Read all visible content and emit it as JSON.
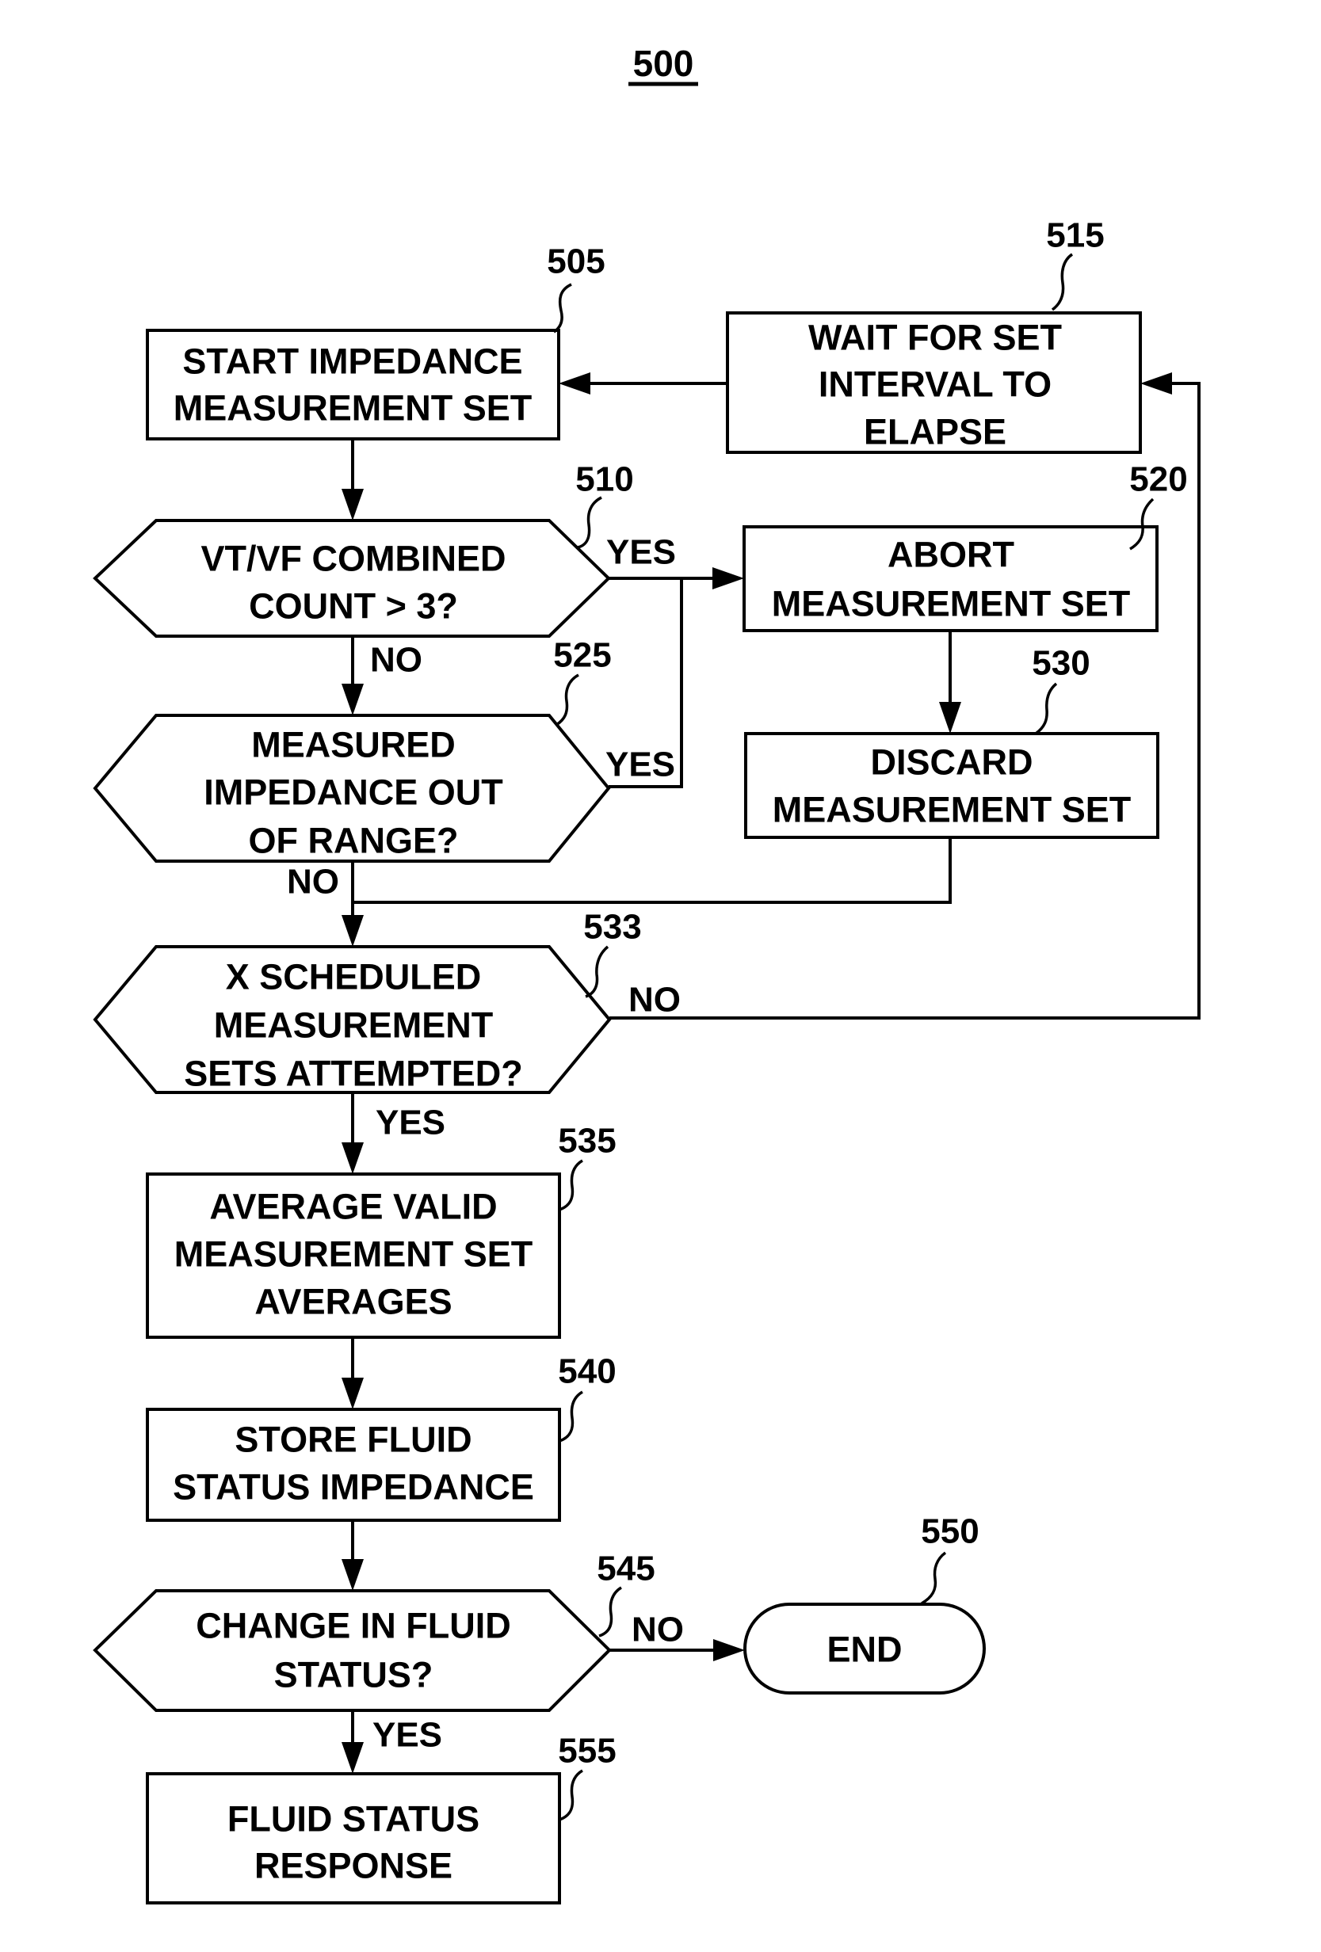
{
  "figure": {
    "number": "500"
  },
  "nodes": {
    "n505": {
      "ref": "505",
      "type": "process",
      "lines": [
        "START IMPEDANCE",
        "MEASUREMENT SET"
      ]
    },
    "n510": {
      "ref": "510",
      "type": "decision",
      "lines": [
        "VT/VF COMBINED",
        "COUNT > 3?"
      ]
    },
    "n515": {
      "ref": "515",
      "type": "process",
      "lines": [
        "WAIT FOR SET",
        "INTERVAL TO",
        "ELAPSE"
      ]
    },
    "n520": {
      "ref": "520",
      "type": "process",
      "lines": [
        "ABORT",
        "MEASUREMENT SET"
      ]
    },
    "n525": {
      "ref": "525",
      "type": "decision",
      "lines": [
        "MEASURED",
        "IMPEDANCE OUT",
        "OF RANGE?"
      ]
    },
    "n530": {
      "ref": "530",
      "type": "process",
      "lines": [
        "DISCARD",
        "MEASUREMENT SET"
      ]
    },
    "n533": {
      "ref": "533",
      "type": "decision",
      "lines": [
        "X SCHEDULED",
        "MEASUREMENT",
        "SETS ATTEMPTED?"
      ]
    },
    "n535": {
      "ref": "535",
      "type": "process",
      "lines": [
        "AVERAGE VALID",
        "MEASUREMENT SET",
        "AVERAGES"
      ]
    },
    "n540": {
      "ref": "540",
      "type": "process",
      "lines": [
        "STORE FLUID",
        "STATUS IMPEDANCE"
      ]
    },
    "n545": {
      "ref": "545",
      "type": "decision",
      "lines": [
        "CHANGE IN FLUID",
        "STATUS?"
      ]
    },
    "n550": {
      "ref": "550",
      "type": "terminal",
      "lines": [
        "END"
      ]
    },
    "n555": {
      "ref": "555",
      "type": "process",
      "lines": [
        "FLUID STATUS",
        "RESPONSE"
      ]
    }
  },
  "edges": {
    "e510_yes": {
      "from": "510",
      "to": "520",
      "label": "YES"
    },
    "e510_no": {
      "from": "510",
      "to": "525",
      "label": "NO"
    },
    "e525_yes": {
      "from": "525",
      "to": "520",
      "label": "YES"
    },
    "e525_no": {
      "from": "525",
      "to": "533",
      "label": "NO"
    },
    "e533_no": {
      "from": "533",
      "to": "515",
      "label": "NO"
    },
    "e533_yes": {
      "from": "533",
      "to": "535",
      "label": "YES"
    },
    "e545_no": {
      "from": "545",
      "to": "550",
      "label": "NO"
    },
    "e545_yes": {
      "from": "545",
      "to": "555",
      "label": "YES"
    }
  }
}
